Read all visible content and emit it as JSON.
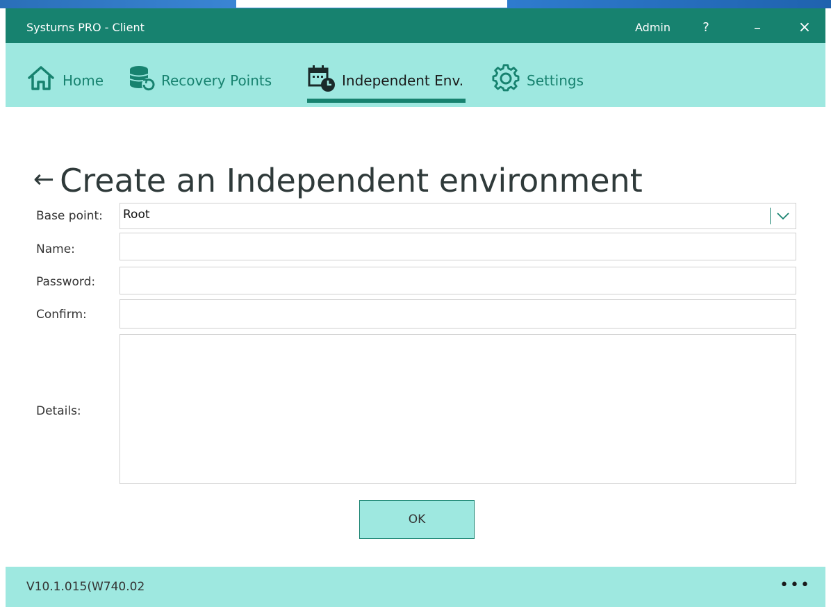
{
  "window": {
    "title": "Systurns PRO - Client",
    "user": "Admin",
    "help": "?",
    "minimize": "–",
    "close": "×"
  },
  "nav": {
    "tabs": [
      {
        "label": "Home",
        "icon": "home-icon"
      },
      {
        "label": "Recovery Points",
        "icon": "database-restore-icon"
      },
      {
        "label": "Independent Env.",
        "icon": "calendar-clock-icon",
        "active": true
      },
      {
        "label": "Settings",
        "icon": "gear-icon"
      }
    ]
  },
  "page": {
    "back": "←",
    "title": "Create an Independent environment"
  },
  "form": {
    "base_point": {
      "label": "Base point:",
      "value": "Root"
    },
    "name": {
      "label": "Name:",
      "value": ""
    },
    "password": {
      "label": "Password:",
      "value": ""
    },
    "confirm": {
      "label": "Confirm:",
      "value": ""
    },
    "details": {
      "label": "Details:",
      "value": ""
    },
    "ok": "OK"
  },
  "footer": {
    "version": "V10.1.015(W740.02",
    "more": "•••"
  },
  "colors": {
    "accent": "#17826f",
    "accent_light": "#9ee8e0",
    "titlebar": "#17826f"
  }
}
